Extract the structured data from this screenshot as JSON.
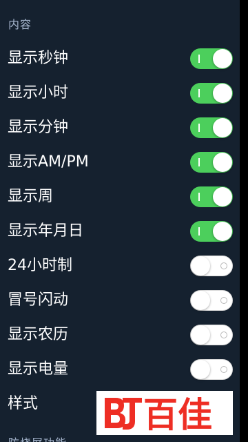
{
  "section_header": "内容",
  "rows": [
    {
      "label": "显示秒钟",
      "enabled": true
    },
    {
      "label": "显示小时",
      "enabled": true
    },
    {
      "label": "显示分钟",
      "enabled": true
    },
    {
      "label": "显示AM/PM",
      "enabled": true
    },
    {
      "label": "显示周",
      "enabled": true
    },
    {
      "label": "显示年月日",
      "enabled": true
    },
    {
      "label": "24小时制",
      "enabled": false
    },
    {
      "label": "冒号闪动",
      "enabled": false
    },
    {
      "label": "显示农历",
      "enabled": false
    },
    {
      "label": "显示电量",
      "enabled": false
    }
  ],
  "style_row": {
    "label": "样式"
  },
  "footer_header": "防烧屏功能",
  "watermark": {
    "text": "百佳",
    "logo_letters": "BJ",
    "color": "#ee2e24"
  },
  "colors": {
    "background": "#15212f",
    "toggle_on": "#4ccf5c",
    "toggle_off": "#ffffff",
    "label": "#ffffff",
    "header": "#a7b7cf"
  }
}
